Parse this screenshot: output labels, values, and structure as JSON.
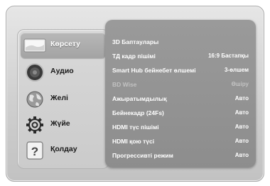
{
  "sidebar": {
    "items": [
      {
        "label": "Көрсету",
        "icon": "display-icon",
        "active": true
      },
      {
        "label": "Аудио",
        "icon": "speaker-icon",
        "active": false
      },
      {
        "label": "Желі",
        "icon": "network-globe-icon",
        "active": false
      },
      {
        "label": "Жүйе",
        "icon": "gear-icon",
        "active": false
      },
      {
        "label": "Қолдау",
        "icon": "help-icon",
        "active": false
      }
    ]
  },
  "settings": {
    "rows": [
      {
        "label": "3D Баптаулары",
        "value": ""
      },
      {
        "label": "ТД кадр пішімі",
        "value": "16:9 Бастапқы"
      },
      {
        "label": "Smart Hub бейнебет өлшемі",
        "value": "3-өлшем"
      },
      {
        "label": "BD Wise",
        "value": "Өшіру",
        "disabled": true
      },
      {
        "label": "Ажыратымдылық",
        "value": "Авто"
      },
      {
        "label": "Бейнекадр (24Fs)",
        "value": "Авто"
      },
      {
        "label": "HDMI түс пішімі",
        "value": "Авто"
      },
      {
        "label": "HDMI қою түсі",
        "value": "Авто"
      },
      {
        "label": "Прогрессивті режим",
        "value": "Авто"
      }
    ]
  }
}
